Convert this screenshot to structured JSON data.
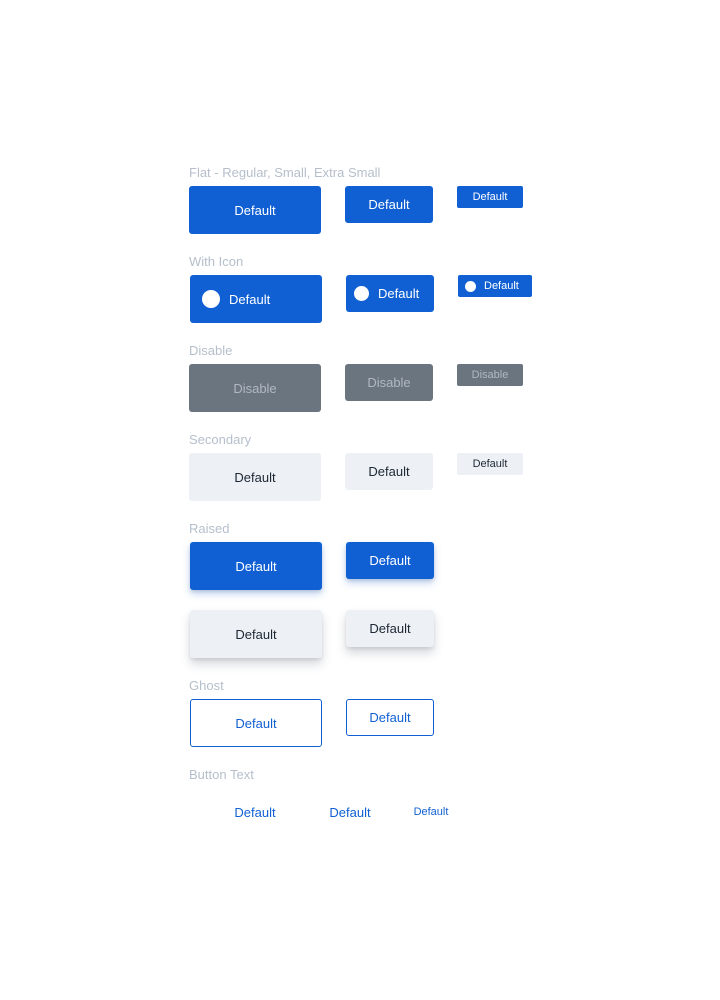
{
  "sections": {
    "flat": {
      "title": "Flat - Regular, Small, Extra Small",
      "regular": "Default",
      "small": "Default",
      "extra_small": "Default"
    },
    "with_icon": {
      "title": "With Icon",
      "regular": "Default",
      "small": "Default",
      "extra_small": "Default",
      "icon": "circle-icon"
    },
    "disable": {
      "title": "Disable",
      "regular": "Disable",
      "small": "Disable",
      "extra_small": "Disable"
    },
    "secondary": {
      "title": "Secondary",
      "regular": "Default",
      "small": "Default",
      "extra_small": "Default"
    },
    "raised": {
      "title": "Raised",
      "primary_regular": "Default",
      "primary_small": "Default",
      "secondary_regular": "Default",
      "secondary_small": "Default"
    },
    "ghost": {
      "title": "Ghost",
      "regular": "Default",
      "small": "Default"
    },
    "button_text": {
      "title": "Button Text",
      "regular": "Default",
      "small": "Default",
      "extra_small": "Default"
    }
  },
  "colors": {
    "primary": "#1160d3",
    "disabled": "#6a7580",
    "secondary": "#edf1f6",
    "label": "#b5bfcb"
  }
}
